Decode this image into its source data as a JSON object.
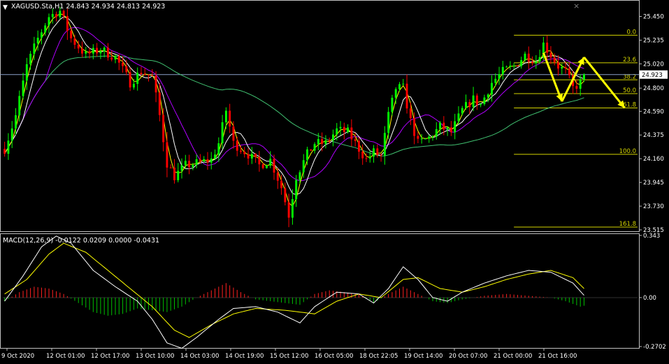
{
  "window": {
    "header": "XAGUSD.Sta,H1  24.843 24.934 24.813 24.923",
    "corner_mark": "×",
    "macd_label": "MACD(12,26,9) -0.0122 0.0209 0.0000 -0.0431"
  },
  "colors": {
    "background": "#000000",
    "frame": "#c0c0c0",
    "bull_candle": "#00ff00",
    "bear_candle": "#ff0000",
    "ma_fast": "#ffff00",
    "ma_mid": "#ffffff",
    "ma_purple": "#b000ff",
    "ma_slow": "#40c070",
    "fib": "#d4d400",
    "arrow": "#ffff00",
    "price_line": "#8aa0c8",
    "hist_pos": "#ff2020",
    "hist_neg": "#00c000"
  },
  "chart_data": [
    {
      "type": "candlestick",
      "symbol": "XAGUSD.Sta",
      "timeframe": "H1",
      "ohlc_last": {
        "open": 24.843,
        "high": 24.934,
        "low": 24.813,
        "close": 24.923
      },
      "current_price": 24.923,
      "ylim": [
        23.515,
        25.58
      ],
      "y_ticks": [
        "25.450",
        "25.235",
        "25.020",
        "24.800",
        "24.590",
        "24.375",
        "24.160",
        "23.945",
        "23.730",
        "23.515"
      ],
      "x_ticks": [
        "9 Oct 2020",
        "12 Oct 01:00",
        "12 Oct 17:00",
        "13 Oct 10:00",
        "14 Oct 03:00",
        "14 Oct 19:00",
        "15 Oct 12:00",
        "16 Oct 05:00",
        "18 Oct 22:05",
        "19 Oct 14:00",
        "20 Oct 07:00",
        "21 Oct 00:00",
        "21 Oct 16:00"
      ],
      "price_path": [
        [
          0,
          24.25
        ],
        [
          3,
          24.55
        ],
        [
          6,
          25.0
        ],
        [
          9,
          25.25
        ],
        [
          12,
          25.45
        ],
        [
          15,
          25.5
        ],
        [
          18,
          25.25
        ],
        [
          22,
          25.1
        ],
        [
          26,
          25.15
        ],
        [
          30,
          25.08
        ],
        [
          34,
          24.85
        ],
        [
          37,
          24.95
        ],
        [
          40,
          24.9
        ],
        [
          42,
          24.55
        ],
        [
          44,
          24.12
        ],
        [
          46,
          24.0
        ],
        [
          49,
          24.1
        ],
        [
          52,
          24.12
        ],
        [
          56,
          24.15
        ],
        [
          58,
          24.3
        ],
        [
          60,
          24.6
        ],
        [
          62,
          24.3
        ],
        [
          64,
          24.25
        ],
        [
          66,
          24.2
        ],
        [
          69,
          24.1
        ],
        [
          72,
          24.15
        ],
        [
          75,
          23.9
        ],
        [
          77,
          23.65
        ],
        [
          79,
          24.0
        ],
        [
          82,
          24.2
        ],
        [
          84,
          24.3
        ],
        [
          87,
          24.3
        ],
        [
          90,
          24.42
        ],
        [
          93,
          24.4
        ],
        [
          96,
          24.25
        ],
        [
          98,
          24.15
        ],
        [
          100,
          24.22
        ],
        [
          102,
          24.18
        ],
        [
          104,
          24.55
        ],
        [
          106,
          24.8
        ],
        [
          108,
          24.8
        ],
        [
          110,
          24.5
        ],
        [
          112,
          24.3
        ],
        [
          115,
          24.35
        ],
        [
          118,
          24.45
        ],
        [
          121,
          24.4
        ],
        [
          124,
          24.6
        ],
        [
          127,
          24.7
        ],
        [
          129,
          24.65
        ],
        [
          132,
          24.85
        ],
        [
          135,
          24.95
        ],
        [
          138,
          25.0
        ],
        [
          141,
          25.1
        ],
        [
          144,
          25.05
        ],
        [
          146,
          25.2
        ],
        [
          148,
          25.1
        ],
        [
          150,
          25.0
        ],
        [
          152,
          24.95
        ],
        [
          154,
          24.8
        ],
        [
          156,
          24.85
        ],
        [
          158,
          24.92
        ]
      ],
      "candles_count": 158,
      "ma_periods_note": "",
      "fibonacci": {
        "levels": [
          {
            "label": "0.0",
            "price": 25.28
          },
          {
            "label": "23.6",
            "price": 25.03
          },
          {
            "label": "38.2",
            "price": 24.875
          },
          {
            "label": "50.0",
            "price": 24.75
          },
          {
            "label": "61.8",
            "price": 24.62
          },
          {
            "label": "100.0",
            "price": 24.2
          },
          {
            "label": "161.8",
            "price": 23.54
          }
        ]
      },
      "arrows": [
        [
          [
            146,
            25.12
          ],
          [
            151,
            24.68
          ]
        ],
        [
          [
            151,
            24.68
          ],
          [
            157,
            25.08
          ]
        ],
        [
          [
            157,
            25.08
          ],
          [
            168,
            24.62
          ]
        ]
      ]
    },
    {
      "type": "macd",
      "params": "12,26,9",
      "values": {
        "macd": -0.0122,
        "signal": 0.0209,
        "zero": 0.0,
        "histogram": -0.0431
      },
      "ylim": [
        -0.2702,
        0.343
      ],
      "y_ticks": [
        "0.343",
        "0.00",
        "-0.2702"
      ],
      "macd_path": [
        [
          0,
          -0.02
        ],
        [
          5,
          0.12
        ],
        [
          10,
          0.28
        ],
        [
          14,
          0.34
        ],
        [
          18,
          0.3
        ],
        [
          24,
          0.15
        ],
        [
          30,
          0.06
        ],
        [
          36,
          -0.02
        ],
        [
          40,
          -0.12
        ],
        [
          44,
          -0.25
        ],
        [
          48,
          -0.28
        ],
        [
          52,
          -0.22
        ],
        [
          58,
          -0.12
        ],
        [
          62,
          -0.06
        ],
        [
          68,
          -0.05
        ],
        [
          74,
          -0.08
        ],
        [
          80,
          -0.14
        ],
        [
          84,
          -0.05
        ],
        [
          90,
          0.03
        ],
        [
          96,
          0.02
        ],
        [
          100,
          -0.03
        ],
        [
          104,
          0.05
        ],
        [
          108,
          0.17
        ],
        [
          112,
          0.1
        ],
        [
          116,
          0.0
        ],
        [
          120,
          -0.02
        ],
        [
          124,
          0.03
        ],
        [
          130,
          0.08
        ],
        [
          136,
          0.12
        ],
        [
          142,
          0.15
        ],
        [
          148,
          0.14
        ],
        [
          154,
          0.08
        ],
        [
          158,
          -0.01
        ]
      ],
      "signal_path": [
        [
          0,
          0.02
        ],
        [
          6,
          0.1
        ],
        [
          12,
          0.24
        ],
        [
          16,
          0.3
        ],
        [
          22,
          0.25
        ],
        [
          28,
          0.15
        ],
        [
          34,
          0.05
        ],
        [
          40,
          -0.05
        ],
        [
          46,
          -0.18
        ],
        [
          50,
          -0.22
        ],
        [
          56,
          -0.15
        ],
        [
          62,
          -0.09
        ],
        [
          68,
          -0.06
        ],
        [
          76,
          -0.07
        ],
        [
          84,
          -0.09
        ],
        [
          90,
          -0.02
        ],
        [
          96,
          0.02
        ],
        [
          102,
          0.0
        ],
        [
          108,
          0.1
        ],
        [
          112,
          0.11
        ],
        [
          118,
          0.05
        ],
        [
          124,
          0.03
        ],
        [
          130,
          0.06
        ],
        [
          136,
          0.1
        ],
        [
          142,
          0.13
        ],
        [
          148,
          0.15
        ],
        [
          154,
          0.11
        ],
        [
          158,
          0.03
        ]
      ],
      "histogram_path": [
        [
          0,
          -0.02
        ],
        [
          4,
          0.03
        ],
        [
          8,
          0.06
        ],
        [
          12,
          0.05
        ],
        [
          16,
          0.02
        ],
        [
          20,
          -0.03
        ],
        [
          24,
          -0.08
        ],
        [
          28,
          -0.1
        ],
        [
          32,
          -0.09
        ],
        [
          36,
          -0.06
        ],
        [
          40,
          -0.07
        ],
        [
          44,
          -0.08
        ],
        [
          48,
          -0.05
        ],
        [
          52,
          0.0
        ],
        [
          56,
          0.04
        ],
        [
          60,
          0.08
        ],
        [
          64,
          0.03
        ],
        [
          68,
          -0.01
        ],
        [
          72,
          -0.02
        ],
        [
          76,
          -0.03
        ],
        [
          80,
          -0.04
        ],
        [
          84,
          0.02
        ],
        [
          88,
          0.04
        ],
        [
          92,
          0.03
        ],
        [
          96,
          0.02
        ],
        [
          100,
          -0.03
        ],
        [
          104,
          0.02
        ],
        [
          108,
          0.06
        ],
        [
          112,
          0.02
        ],
        [
          116,
          -0.02
        ],
        [
          120,
          -0.03
        ],
        [
          124,
          -0.01
        ],
        [
          130,
          0.01
        ],
        [
          136,
          0.02
        ],
        [
          142,
          0.01
        ],
        [
          148,
          0.0
        ],
        [
          152,
          -0.02
        ],
        [
          156,
          -0.05
        ],
        [
          158,
          -0.04
        ]
      ]
    }
  ]
}
